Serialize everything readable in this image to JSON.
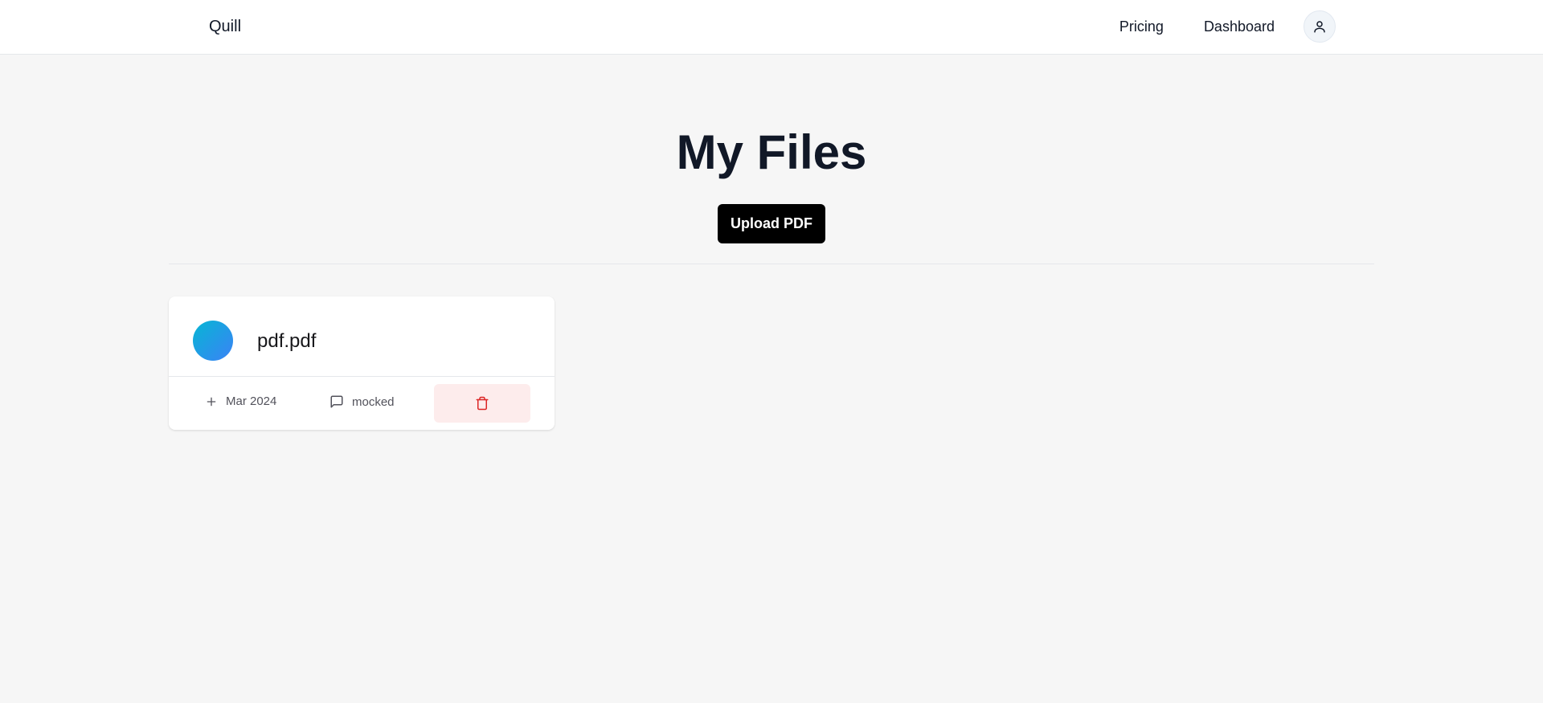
{
  "nav": {
    "brand": "Quill",
    "links": [
      "Pricing",
      "Dashboard"
    ],
    "avatar_icon": "user-icon"
  },
  "main": {
    "title": "My Files",
    "upload_label": "Upload PDF"
  },
  "files": [
    {
      "name": "pdf.pdf",
      "created": "Mar 2024",
      "messages": "mocked",
      "created_icon": "plus-icon",
      "messages_icon": "message-square-icon",
      "delete_icon": "trash-icon"
    }
  ],
  "colors": {
    "accent_gradient": [
      "#06b6d4",
      "#3b82f6"
    ],
    "delete_bg": "#fdecec",
    "delete_icon": "#dc2626",
    "button_bg": "#000000"
  }
}
